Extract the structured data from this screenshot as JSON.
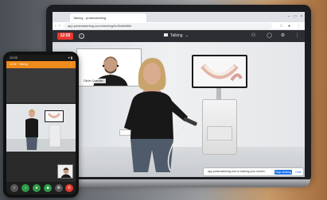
{
  "browser": {
    "tab_title": "Talking - pridematching",
    "url": "app.pridematching.com/meeting/9c35d4eff8d"
  },
  "meeting": {
    "timer": "12:02",
    "status": "Talking",
    "pip_name": "Olivier Querrion"
  },
  "share": {
    "message": "app.pridematching.com is sharing your screen.",
    "stop_label": "Stop sharing",
    "hide_label": "Hide"
  },
  "phone": {
    "time": "12:02",
    "header_title": "12:02 · Talking",
    "status_icons": "▾ ▮"
  },
  "colors": {
    "timer_red": "#e9382f",
    "phone_orange": "#ef8a1c",
    "accent_blue": "#1a73e8"
  }
}
